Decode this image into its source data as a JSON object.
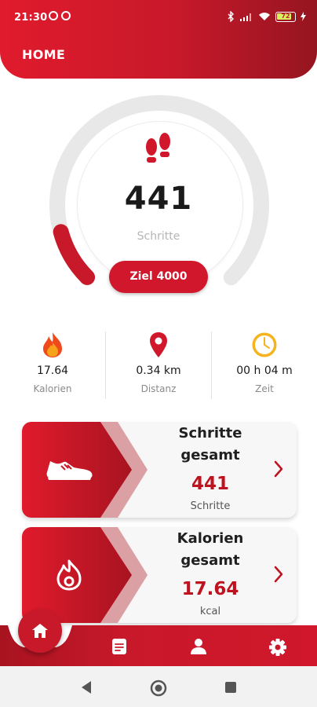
{
  "status_bar": {
    "time": "21:30",
    "battery": "72"
  },
  "header": {
    "title": "HOME"
  },
  "ring": {
    "steps": "441",
    "steps_label": "Schritte",
    "goal_button": "Ziel 4000",
    "progress": 0.11
  },
  "stats": [
    {
      "value": "17.64",
      "label": "Kalorien",
      "icon": "flame-icon"
    },
    {
      "value": "0.34 km",
      "label": "Distanz",
      "icon": "location-pin-icon"
    },
    {
      "value": "00 h 04 m",
      "label": "Zeit",
      "icon": "clock-icon"
    }
  ],
  "cards": [
    {
      "title_line1": "Schritte",
      "title_line2": "gesamt",
      "value": "441",
      "unit": "Schritte",
      "icon": "sneaker-icon"
    },
    {
      "title_line1": "Kalorien",
      "title_line2": "gesamt",
      "value": "17.64",
      "unit": "kcal",
      "icon": "flame-outline-icon"
    }
  ],
  "nav": {
    "items": [
      "home-icon",
      "notes-icon",
      "profile-icon",
      "settings-gear-icon"
    ]
  },
  "colors": {
    "primary": "#d0172b",
    "dark_red": "#951520",
    "ring_track": "#e8e8e8"
  }
}
